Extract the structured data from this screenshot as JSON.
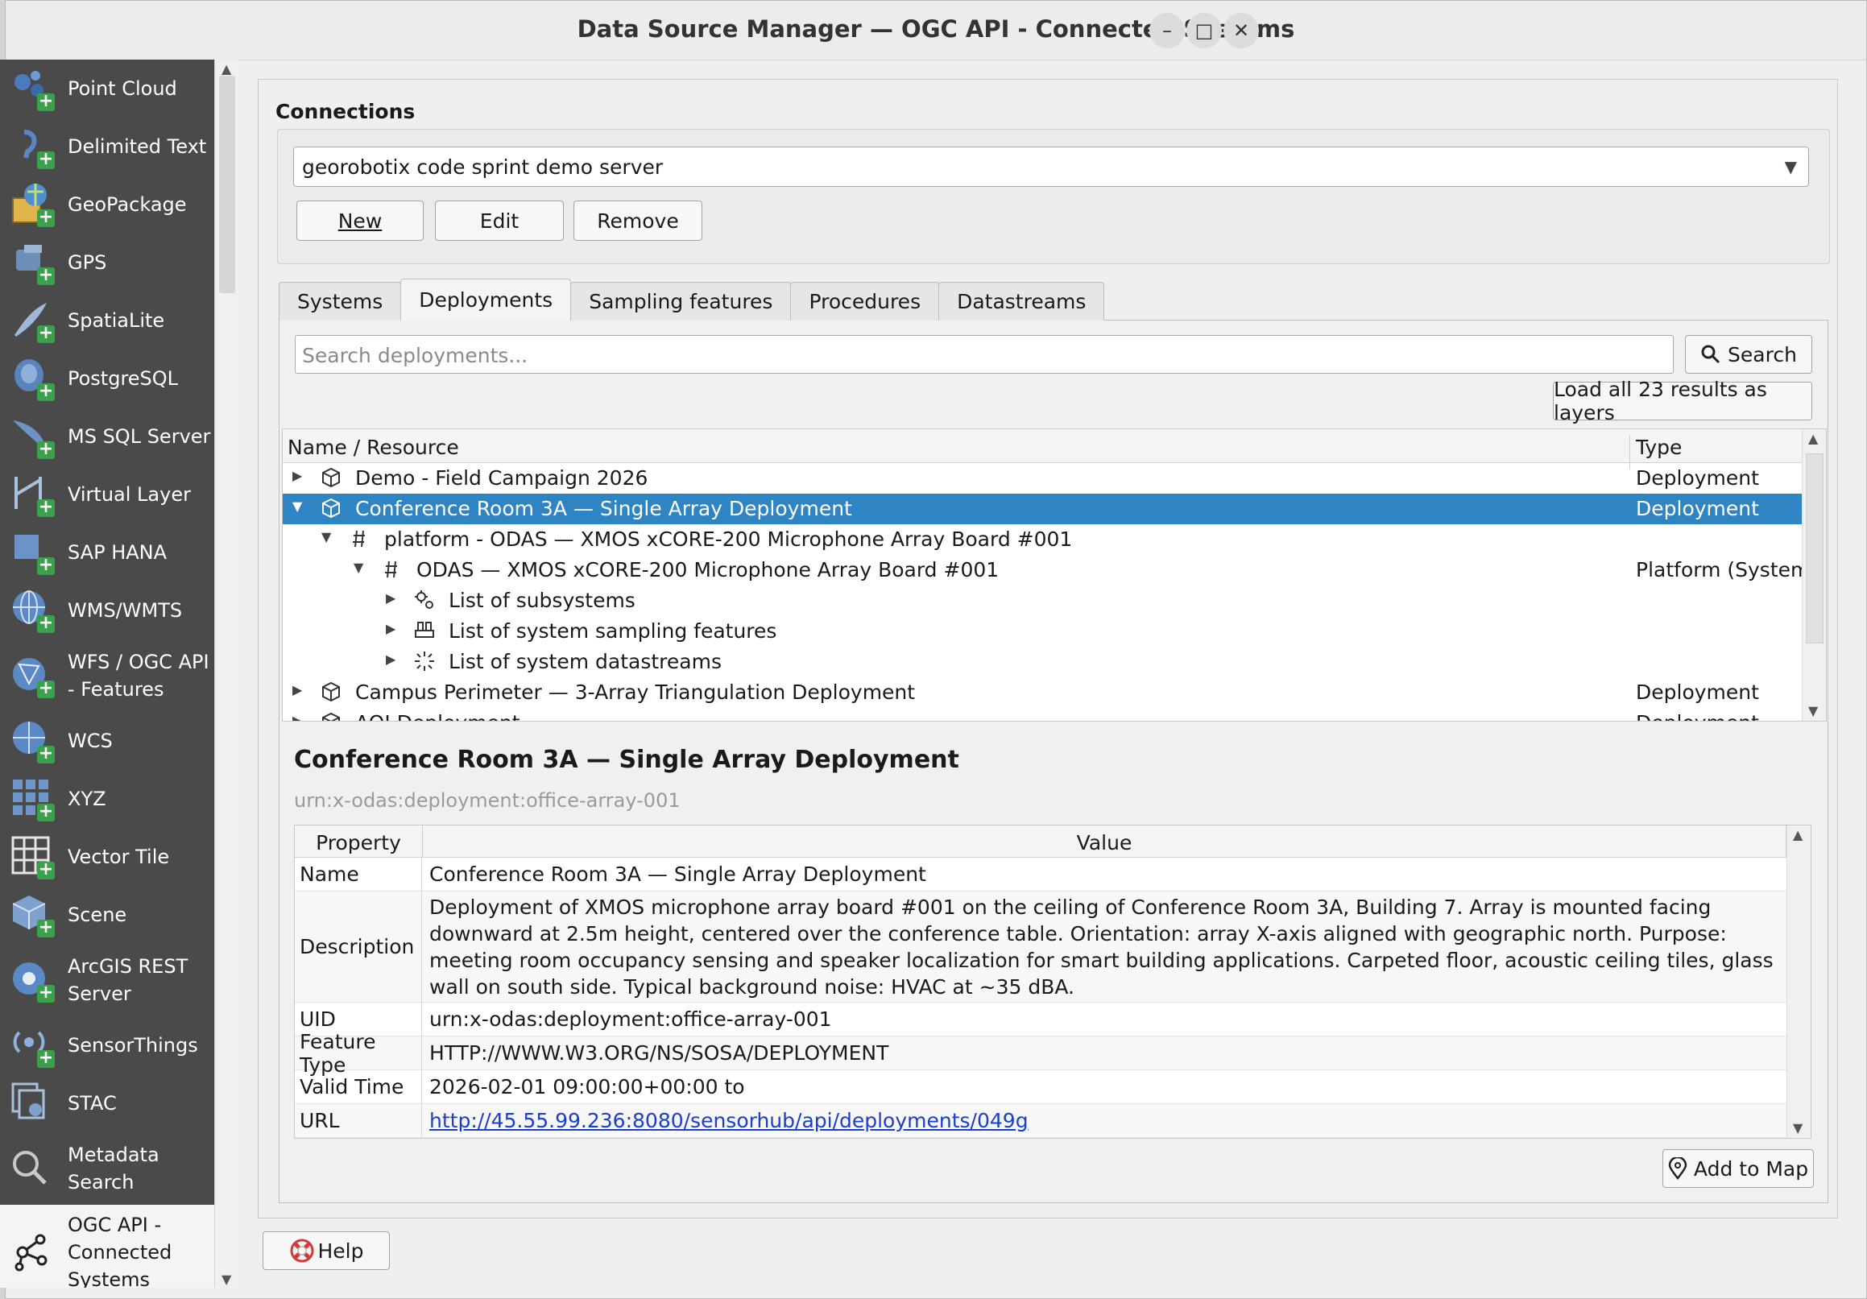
{
  "window": {
    "title": "Data Source Manager — OGC API - Connected Systems",
    "minimize": "–",
    "maximize": "□",
    "close": "✕"
  },
  "sidebar": {
    "items": [
      {
        "label": "Point Cloud",
        "icon": "point-cloud-icon"
      },
      {
        "label": "Delimited Text",
        "icon": "delimited-text-icon"
      },
      {
        "label": "GeoPackage",
        "icon": "geopackage-icon"
      },
      {
        "label": "GPS",
        "icon": "gps-icon"
      },
      {
        "label": "SpatiaLite",
        "icon": "spatialite-icon"
      },
      {
        "label": "PostgreSQL",
        "icon": "postgresql-icon"
      },
      {
        "label": "MS SQL Server",
        "icon": "mssql-icon"
      },
      {
        "label": "Virtual Layer",
        "icon": "virtual-layer-icon"
      },
      {
        "label": "SAP HANA",
        "icon": "sap-hana-icon"
      },
      {
        "label": "WMS/WMTS",
        "icon": "wms-icon"
      },
      {
        "label": "WFS / OGC API - Features",
        "icon": "wfs-icon"
      },
      {
        "label": "WCS",
        "icon": "wcs-icon"
      },
      {
        "label": "XYZ",
        "icon": "xyz-icon"
      },
      {
        "label": "Vector Tile",
        "icon": "vector-tile-icon"
      },
      {
        "label": "Scene",
        "icon": "scene-icon"
      },
      {
        "label": "ArcGIS REST Server",
        "icon": "arcgis-icon"
      },
      {
        "label": "SensorThings",
        "icon": "sensorthings-icon"
      },
      {
        "label": "STAC",
        "icon": "stac-icon"
      },
      {
        "label": "Metadata Search",
        "icon": "metadata-search-icon"
      },
      {
        "label": "OGC API - Connected Systems",
        "icon": "connected-systems-icon"
      }
    ]
  },
  "connections": {
    "heading": "Connections",
    "selected": "georobotix code sprint demo server",
    "new_label": "New",
    "edit_label": "Edit",
    "remove_label": "Remove"
  },
  "tabs": [
    "Systems",
    "Deployments",
    "Sampling features",
    "Procedures",
    "Datastreams"
  ],
  "active_tab": "Deployments",
  "search": {
    "placeholder": "Search deployments...",
    "button": "Search",
    "load_all": "Load all 23 results as layers"
  },
  "tree": {
    "headers": {
      "name": "Name / Resource",
      "type": "Type"
    },
    "rows": [
      {
        "name": "Demo - Field Campaign 2026",
        "type": "Deployment"
      },
      {
        "name": "Conference Room 3A — Single Array Deployment",
        "type": "Deployment"
      },
      {
        "name": "platform - ODAS — XMOS xCORE-200 Microphone Array Board #001",
        "type": ""
      },
      {
        "name": "ODAS — XMOS xCORE-200 Microphone Array Board #001",
        "type": "Platform (System)"
      },
      {
        "name": "List of subsystems",
        "type": ""
      },
      {
        "name": "List of system sampling features",
        "type": ""
      },
      {
        "name": "List of system datastreams",
        "type": ""
      },
      {
        "name": "Campus Perimeter — 3-Array Triangulation Deployment",
        "type": "Deployment"
      },
      {
        "name": "AOI Deployment",
        "type": "Deployment"
      }
    ]
  },
  "details": {
    "title": "Conference Room 3A — Single Array Deployment",
    "uid": "urn:x-odas:deployment:office-array-001",
    "headers": {
      "property": "Property",
      "value": "Value"
    },
    "properties": [
      {
        "key": "Name",
        "value": "Conference Room 3A — Single Array Deployment"
      },
      {
        "key": "Description",
        "value": "Deployment of XMOS microphone array board #001 on the ceiling of Conference Room 3A, Building 7. Array is mounted facing downward at 2.5m height, centered over the conference table. Orientation: array X-axis aligned with geographic north. Purpose: meeting room occupancy sensing and speaker localization for smart building applications. Carpeted floor, acoustic ceiling tiles, glass wall on south side. Typical background noise: HVAC at ~35 dBA."
      },
      {
        "key": "UID",
        "value": "urn:x-odas:deployment:office-array-001"
      },
      {
        "key": "Feature Type",
        "value": "HTTP://WWW.W3.ORG/NS/SOSA/DEPLOYMENT"
      },
      {
        "key": "Valid Time",
        "value": "2026-02-01 09:00:00+00:00 to"
      },
      {
        "key": "URL",
        "value": "http://45.55.99.236:8080/sensorhub/api/deployments/049g"
      }
    ],
    "add_to_map": "Add to Map"
  },
  "help_label": "Help",
  "colors": {
    "selection": "#2f84c4",
    "sidebar": "#4a4a4a",
    "link": "#1a3ecf"
  }
}
